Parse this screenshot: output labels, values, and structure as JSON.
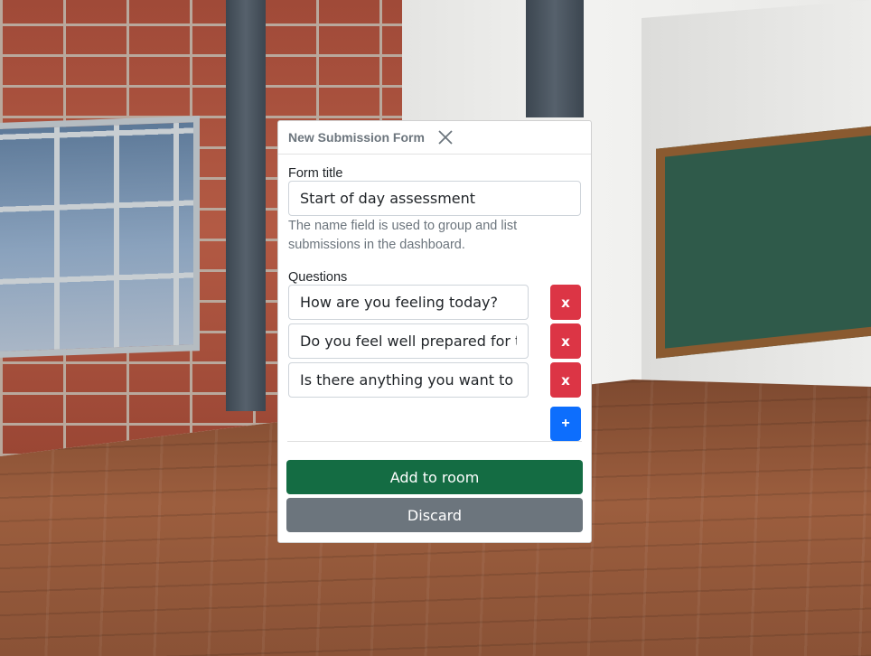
{
  "modal": {
    "title": "New Submission Form",
    "close_icon": "close-icon"
  },
  "form": {
    "title_label": "Form title",
    "title_value": "Start of day assessment",
    "help_text": "The name field is used to group and list submissions in the dashboard.",
    "questions_label": "Questions",
    "questions": [
      {
        "value": "How are you feeling today?",
        "remove_label": "x"
      },
      {
        "value": "Do you feel well prepared for today?",
        "remove_label": "x"
      },
      {
        "value": "Is there anything you want to get off your chest?",
        "remove_label": "x"
      }
    ],
    "add_question_label": "+"
  },
  "actions": {
    "add_to_room": "Add to room",
    "discard": "Discard"
  },
  "colors": {
    "danger": "#dc3545",
    "primary": "#0d6efd",
    "success": "#146c43",
    "secondary": "#6c757d"
  }
}
